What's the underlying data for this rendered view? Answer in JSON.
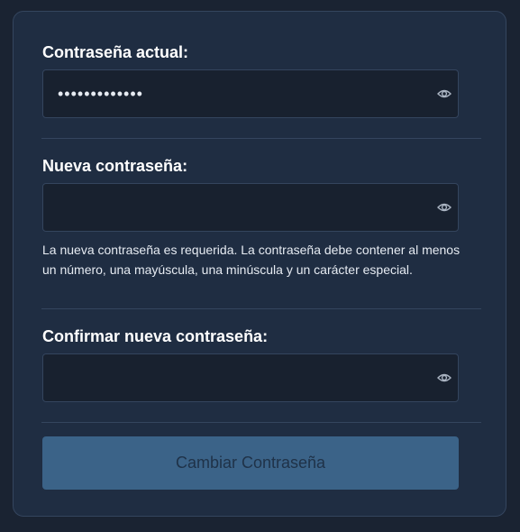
{
  "form": {
    "current_password": {
      "label": "Contraseña actual:",
      "value": "•••••••••••••",
      "icon": "eye-icon"
    },
    "new_password": {
      "label": "Nueva contraseña:",
      "value": "",
      "icon": "eye-icon",
      "hint": "La nueva contraseña es requerida. La contraseña debe contener al menos un número, una mayúscula, una minúscula y un carácter especial."
    },
    "confirm_password": {
      "label": "Confirmar nueva contraseña:",
      "value": "",
      "icon": "eye-icon"
    },
    "submit_label": "Cambiar Contraseña"
  },
  "colors": {
    "page_bg": "#1a2332",
    "card_bg": "#1f2d42",
    "input_bg": "#18212f",
    "border": "#34455e",
    "button_bg": "#3b6388",
    "button_text": "#1f3248",
    "text": "#ffffff"
  }
}
